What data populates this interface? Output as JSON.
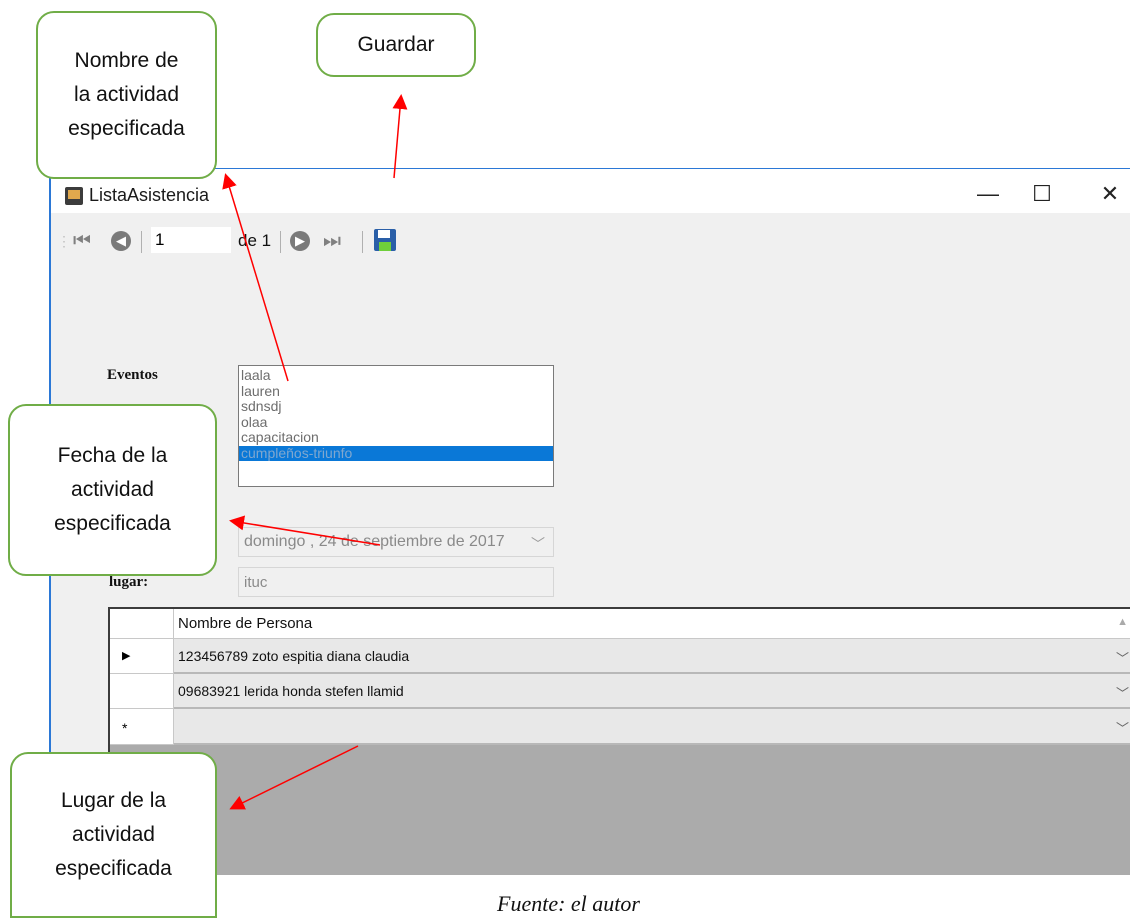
{
  "window": {
    "title": "ListaAsistencia",
    "minimize": "—",
    "maximize": "☐",
    "close": "✕"
  },
  "toolbar": {
    "position_value": "1",
    "of_label": "de 1",
    "first_icon": "first-record-icon",
    "prev_icon": "previous-icon",
    "next_icon": "next-icon",
    "last_icon": "last-record-icon",
    "save_icon": "save-icon"
  },
  "form": {
    "eventos_label": "Eventos",
    "eventos_items": [
      "laala",
      "lauren",
      "sdnsdj",
      "olaa",
      "capacitacion",
      "cumpleños-triunfo"
    ],
    "selected_index": 5,
    "date_value": "domingo , 24 de septiembre de 2017",
    "lugar_label": "lugar:",
    "lugar_value": "ituc"
  },
  "grid": {
    "column_header": "Nombre de Persona",
    "rows": [
      {
        "marker": "▶",
        "value": "123456789 zoto espitia diana claudia"
      },
      {
        "marker": "",
        "value": "09683921 lerida honda  stefen  llamid"
      },
      {
        "marker": "*",
        "value": ""
      }
    ]
  },
  "callouts": {
    "guardar": "Guardar",
    "nombre": [
      "Nombre de",
      "la actividad",
      "especificada"
    ],
    "fecha": [
      "Fecha de la",
      "actividad",
      "especificada"
    ],
    "lugar": [
      "Lugar de la",
      "actividad",
      "especificada"
    ]
  },
  "caption": "Fuente: el autor",
  "colors": {
    "callout_border": "#70ad47",
    "arrow": "#ff0000",
    "selection": "#0a78d7"
  }
}
